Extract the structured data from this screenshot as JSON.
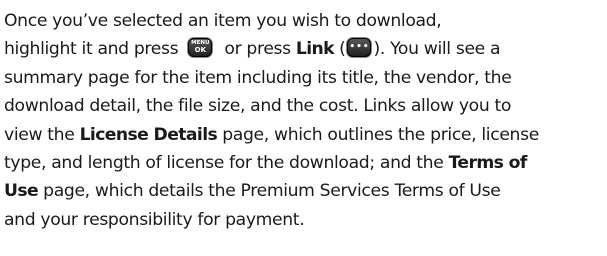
{
  "doc": {
    "l1": "Once you’ve selected an item you wish to download,",
    "l2a": "highlight it and press ",
    "l2b": " or press ",
    "l2c": "Link",
    "l2d": " (",
    "l2e": "). You will see a",
    "l3": "summary page for the item including its title, the vendor, the",
    "l4": "download detail, the file size, and the cost. Links allow you to",
    "l5a": "view the ",
    "l5b": "License Details",
    "l5c": " page, which outlines the price, license",
    "l6a": "type, and length of license for the download; and the ",
    "l6b": "Terms of",
    "l7a": "Use",
    "l7b": " page, which details the Premium Services Terms of Use",
    "l8": "and your responsibility for payment."
  },
  "keys": {
    "menu_top": "MENU",
    "menu_bottom": "OK",
    "link_dots": "•••"
  }
}
